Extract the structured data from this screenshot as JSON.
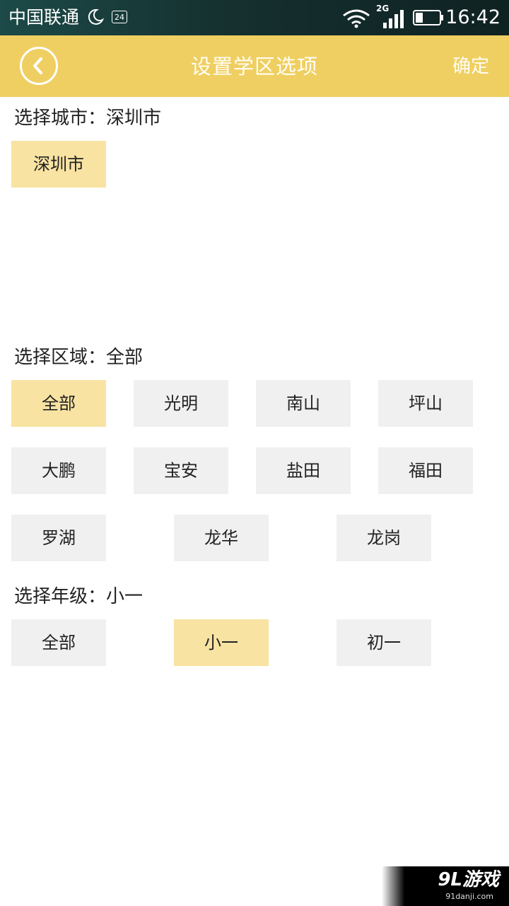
{
  "status_bar": {
    "carrier": "中国联通",
    "sim_badge": "24",
    "network_type": "2G",
    "time": "16:42",
    "icons": [
      "moon-icon",
      "wifi-icon",
      "signal-icon",
      "battery-icon"
    ]
  },
  "header": {
    "title": "设置学区选项",
    "confirm_label": "确定",
    "back_icon": "chevron-left-icon",
    "background_color": "#efcf62"
  },
  "city": {
    "label": "选择城市：深圳市",
    "options": [
      {
        "label": "深圳市",
        "selected": true
      }
    ]
  },
  "district": {
    "label": "选择区域：全部",
    "options": [
      {
        "label": "全部",
        "selected": true
      },
      {
        "label": "光明",
        "selected": false
      },
      {
        "label": "南山",
        "selected": false
      },
      {
        "label": "坪山",
        "selected": false
      },
      {
        "label": "大鹏",
        "selected": false
      },
      {
        "label": "宝安",
        "selected": false
      },
      {
        "label": "盐田",
        "selected": false
      },
      {
        "label": "福田",
        "selected": false
      },
      {
        "label": "罗湖",
        "selected": false
      },
      {
        "label": "龙华",
        "selected": false
      },
      {
        "label": "龙岗",
        "selected": false
      }
    ]
  },
  "grade": {
    "label": "选择年级：小一",
    "options": [
      {
        "label": "全部",
        "selected": false
      },
      {
        "label": "小一",
        "selected": true
      },
      {
        "label": "初一",
        "selected": false
      }
    ]
  },
  "colors": {
    "chip_selected": "#f8e3a2",
    "chip_default": "#f0f0f0"
  },
  "watermark": {
    "main": "9L游戏",
    "sub": "91danji.com"
  }
}
